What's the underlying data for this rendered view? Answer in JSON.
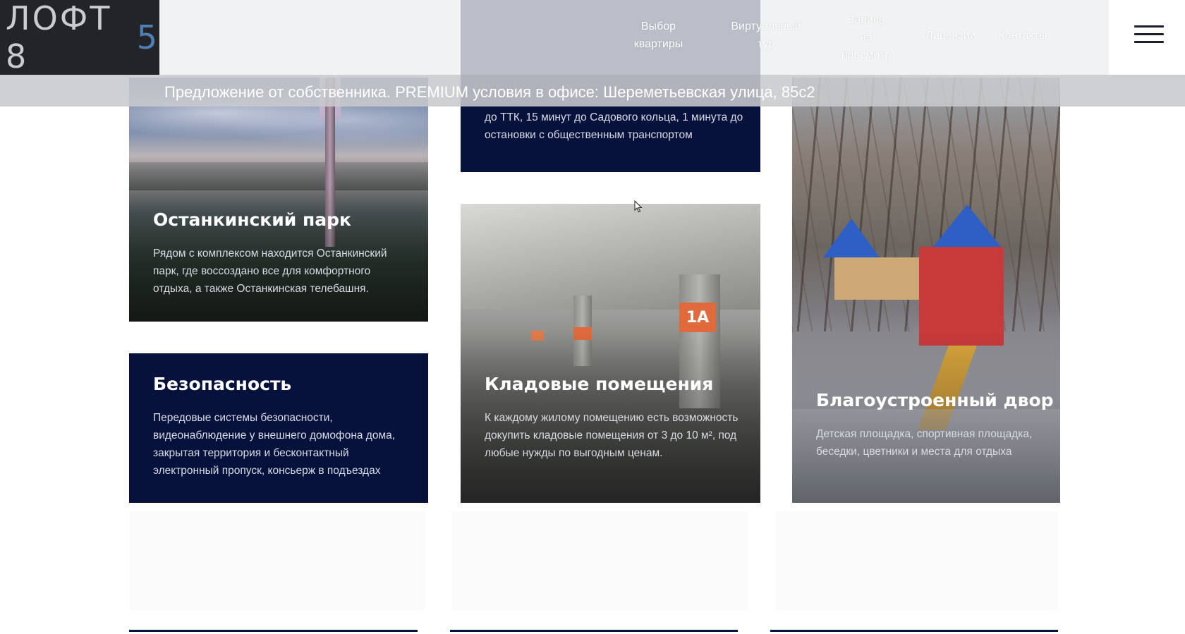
{
  "header": {
    "logo_text": "ЛОФТ 8",
    "logo_accent": "5",
    "nav": {
      "item1_line1": "Выбор",
      "item1_line2": "квартиры",
      "item2_line1": "Виртуальный",
      "item2_line2": "тур",
      "item3_line1": "Запись",
      "item3_line2": "на",
      "item3_line3": "просмотр",
      "item4": "Лицензии",
      "item5": "Контакты"
    },
    "menu_icon": "hamburger-menu-icon"
  },
  "promo": {
    "text": "Предложение от собственника. PREMIUM условия в офисе: Шереметьевская улица, 85с2"
  },
  "cards": {
    "transport": {
      "text": "до ТТК, 15 минут до Садового кольца, 1 минута до остановки с общественным транспортом"
    },
    "park": {
      "title": "Останкинский парк",
      "text": "Рядом с комплексом находится Останкинский парк, где воссоздано все для комфортного отдыха, а также Останкинская телебашня."
    },
    "storage": {
      "title": "Кладовые помещения",
      "text": "К каждому жилому помещению есть возможность докупить кладовые помещения от 3 до 10 м², под любые нужды по выгодным ценам.",
      "photo_tag": "1А"
    },
    "security": {
      "title": "Безопасность",
      "text": "Передовые системы безопасности, видеонаблюдение у внешнего домофона дома, закрытая территория и бесконтактный электронный пропуск, консьерж в подъездах"
    },
    "yard": {
      "title": "Благоустроенный двор",
      "text": "Детская площадка, спортивная площадка, беседки, цветники и места для отдыха"
    }
  },
  "colors": {
    "navy": "#06123b",
    "logo_bg": "#232427",
    "logo_accent": "#4f7fb4"
  }
}
